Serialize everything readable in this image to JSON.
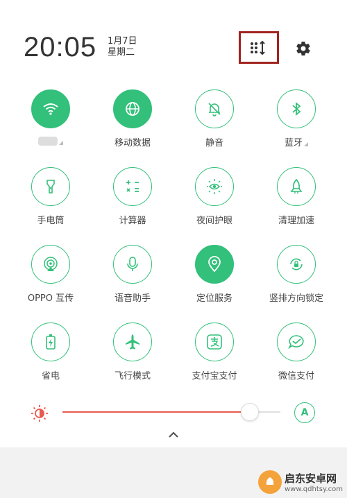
{
  "header": {
    "time": "20:05",
    "date": "1月7日",
    "weekday": "星期二"
  },
  "tiles": [
    {
      "label": "",
      "icon": "wifi-icon",
      "on": true
    },
    {
      "label": "移动数据",
      "icon": "globe-icon",
      "on": true
    },
    {
      "label": "静音",
      "icon": "bell-off-icon",
      "on": false
    },
    {
      "label": "蓝牙",
      "icon": "bluetooth-icon",
      "on": false
    },
    {
      "label": "手电筒",
      "icon": "flashlight-icon",
      "on": false
    },
    {
      "label": "计算器",
      "icon": "calculator-icon",
      "on": false
    },
    {
      "label": "夜间护眼",
      "icon": "eye-sun-icon",
      "on": false
    },
    {
      "label": "清理加速",
      "icon": "rocket-icon",
      "on": false
    },
    {
      "label": "OPPO 互传",
      "icon": "share-signal-icon",
      "on": false
    },
    {
      "label": "语音助手",
      "icon": "microphone-icon",
      "on": false
    },
    {
      "label": "定位服务",
      "icon": "location-pin-icon",
      "on": true
    },
    {
      "label": "竖排方向锁定",
      "icon": "rotation-lock-icon",
      "on": false
    },
    {
      "label": "省电",
      "icon": "battery-saver-icon",
      "on": false
    },
    {
      "label": "飞行模式",
      "icon": "airplane-icon",
      "on": false
    },
    {
      "label": "支付宝支付",
      "icon": "alipay-icon",
      "on": false
    },
    {
      "label": "微信支付",
      "icon": "wechat-pay-icon",
      "on": false
    }
  ],
  "brightness": {
    "level": 0.86,
    "auto_label": "A"
  },
  "colors": {
    "accent": "#32c07a",
    "slider": "#e85a4f",
    "highlight_box": "#a1231f"
  },
  "watermark": {
    "name": "启东安卓网",
    "url": "www.qdhtsy.com"
  }
}
